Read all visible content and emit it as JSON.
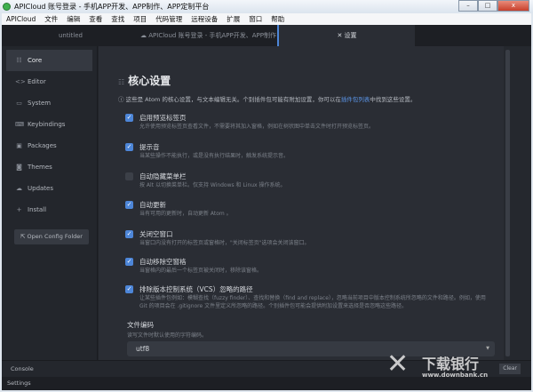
{
  "window": {
    "title": "APICloud 账号登录 - 手机APP开发、APP制作、APP定制平台",
    "minimize": "–",
    "maximize": "□",
    "close": "x"
  },
  "menu": [
    "APICloud",
    "文件",
    "编辑",
    "查看",
    "查找",
    "项目",
    "代码管理",
    "远程设备",
    "扩展",
    "窗口",
    "帮助"
  ],
  "tabs": [
    {
      "label": "untitled"
    },
    {
      "label": "APICloud 账号登录 - 手机APP开发、APP制作"
    },
    {
      "label": "设置"
    }
  ],
  "sidebar": {
    "items": [
      {
        "label": "Core",
        "icon": "sliders-icon",
        "glyph": "☷"
      },
      {
        "label": "Editor",
        "icon": "code-icon",
        "glyph": "<>"
      },
      {
        "label": "System",
        "icon": "monitor-icon",
        "glyph": "▭"
      },
      {
        "label": "Keybindings",
        "icon": "keyboard-icon",
        "glyph": "⌨"
      },
      {
        "label": "Packages",
        "icon": "package-icon",
        "glyph": "▣"
      },
      {
        "label": "Themes",
        "icon": "paint-bucket-icon",
        "glyph": "◙"
      },
      {
        "label": "Updates",
        "icon": "cloud-download-icon",
        "glyph": "☁"
      },
      {
        "label": "Install",
        "icon": "plus-icon",
        "glyph": "+"
      }
    ],
    "open_config": "Open Config Folder"
  },
  "main": {
    "title": "核心设置",
    "info_prefix": "这些是 Atom 的核心设置，与文本编辑无关。个别插件包可能有附加设置，你可以在",
    "info_link": "插件包列表",
    "info_suffix": "中找到这些设置。",
    "options": [
      {
        "title": "启用预览标签页",
        "desc": "允许使用预览标签页查看文件，不需要将其加入窗格，例如在树状图中单击文件时打开预览标签页。",
        "checked": true
      },
      {
        "title": "提示音",
        "desc": "当某些操作不能执行，或是没有执行结果时，触发系统提示音。",
        "checked": true
      },
      {
        "title": "自动隐藏菜单栏",
        "desc": "按 Alt 以切换菜单栏。仅支持 Windows 和 Linux 操作系统。",
        "checked": false
      },
      {
        "title": "自动更新",
        "desc": "当有可用的更新时，自动更新 Atom 。",
        "checked": true
      },
      {
        "title": "关闭空窗口",
        "desc": "当窗口内没有打开的标签页或窗格时，\"关闭标签页\"选项会关闭该窗口。",
        "checked": true
      },
      {
        "title": "自动移除空窗格",
        "desc": "当窗格内的最后一个标签页被关闭时，移除该窗格。",
        "checked": true
      },
      {
        "title": "排除版本控制系统（VCS）忽略的路径",
        "desc": "让某些插件包例如：模糊查找（fuzzy finder）、查找和替换（find and replace），忽略当前项目中版本控制系统所忽略的文件和路径。例如，使用 Git 的项目会在 .gitignore 文件里定义所忽略的路径。个别插件包可能会提供附加设置来选择是否忽略这些路径。",
        "checked": true
      }
    ],
    "encoding": {
      "title": "文件编码",
      "desc": "读写文件时默认使用的字符编码。",
      "value": "utf8"
    }
  },
  "console": {
    "label": "Console",
    "clear": "Clear"
  },
  "status": {
    "label": "Settings"
  },
  "watermark": {
    "name": "下载银行",
    "url": "www.downbank.cn"
  },
  "colors": {
    "accent": "#4d86d8",
    "link": "#5b95e8",
    "background": "#2a2d34"
  }
}
